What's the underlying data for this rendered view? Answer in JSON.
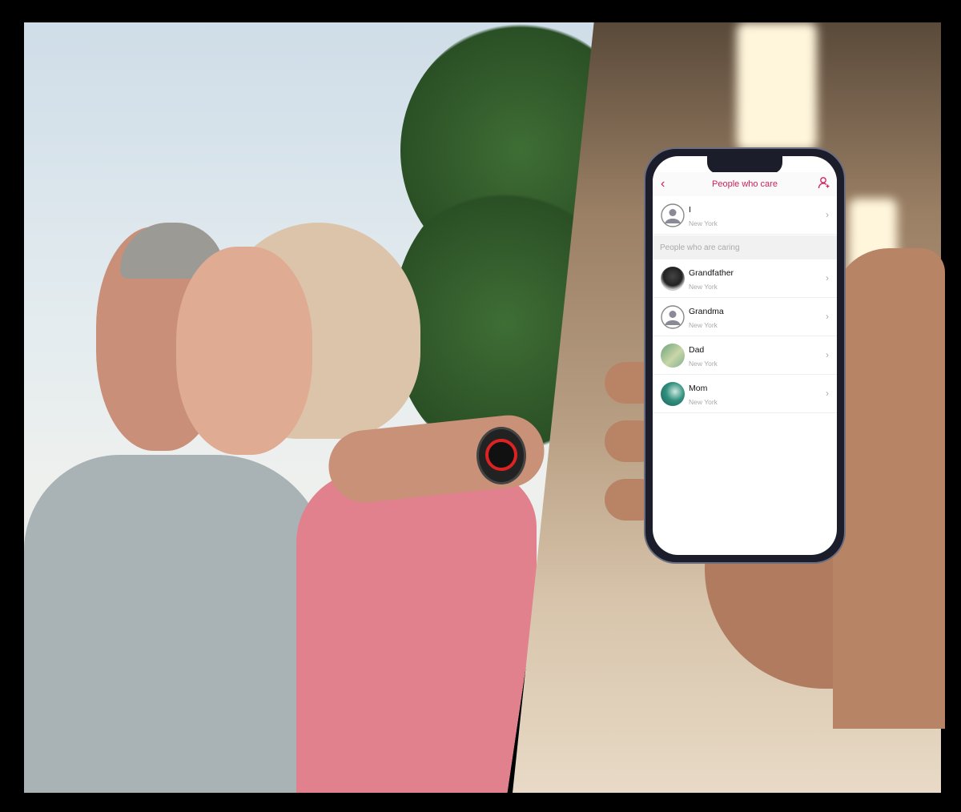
{
  "app": {
    "header": {
      "title": "People who care",
      "back_icon": "chevron-left-icon",
      "add_icon": "add-user-icon"
    },
    "me": {
      "name": "I",
      "location": "New York"
    },
    "section_title": "People who are caring",
    "contacts": [
      {
        "name": "Grandfather",
        "location": "New York"
      },
      {
        "name": "Grandma",
        "location": "New York"
      },
      {
        "name": "Dad",
        "location": "New York"
      },
      {
        "name": "Mom",
        "location": "New York"
      }
    ],
    "accent": "#d01e5e"
  }
}
